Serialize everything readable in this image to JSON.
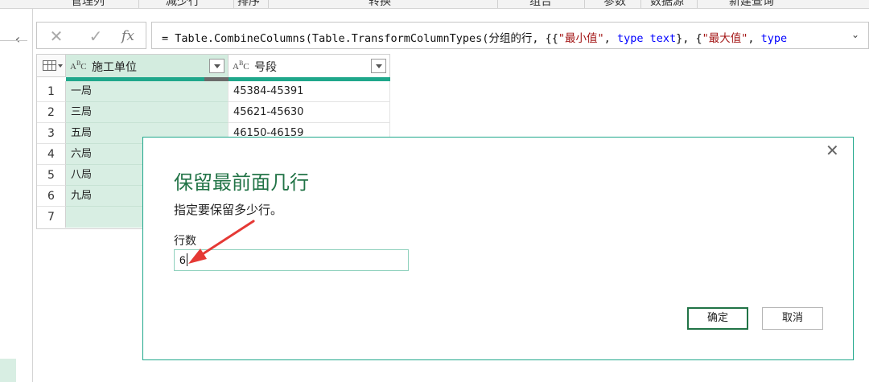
{
  "ribbon": {
    "items": [
      "管理列",
      "减少行",
      "排序",
      "转换",
      "组合",
      "参数",
      "数据源",
      "新建查询"
    ]
  },
  "formula_bar": {
    "cancel_icon": "close-icon",
    "commit_icon": "check-icon",
    "fx_label": "fx",
    "formula_parts": [
      {
        "text": "= Table.CombineColumns(Table.TransformColumnTypes(分组的行, {{",
        "kind": "plain"
      },
      {
        "text": "\"最小值\"",
        "kind": "str"
      },
      {
        "text": ", ",
        "kind": "plain"
      },
      {
        "text": "type text",
        "kind": "kw"
      },
      {
        "text": "}, {",
        "kind": "plain"
      },
      {
        "text": "\"最大值\"",
        "kind": "str"
      },
      {
        "text": ", ",
        "kind": "plain"
      },
      {
        "text": "type",
        "kind": "kw"
      }
    ]
  },
  "grid": {
    "columns": [
      {
        "type_label": "ABC",
        "name": "施工单位",
        "selected": true
      },
      {
        "type_label": "ABC",
        "name": "号段",
        "selected": false
      }
    ],
    "rows": [
      {
        "num": "1",
        "cells": [
          "一局",
          "45384-45391"
        ]
      },
      {
        "num": "2",
        "cells": [
          "三局",
          "45621-45630"
        ]
      },
      {
        "num": "3",
        "cells": [
          "五局",
          "46150-46159"
        ]
      },
      {
        "num": "4",
        "cells": [
          "六局",
          ""
        ]
      },
      {
        "num": "5",
        "cells": [
          "八局",
          ""
        ]
      },
      {
        "num": "6",
        "cells": [
          "九局",
          ""
        ]
      },
      {
        "num": "7",
        "cells": [
          "",
          ""
        ]
      }
    ]
  },
  "dialog": {
    "title": "保留最前面几行",
    "description": "指定要保留多少行。",
    "field_label": "行数",
    "field_value": "6",
    "ok_label": "确定",
    "cancel_label": "取消",
    "accent_color": "#217346",
    "annotation_color": "#e53935"
  }
}
